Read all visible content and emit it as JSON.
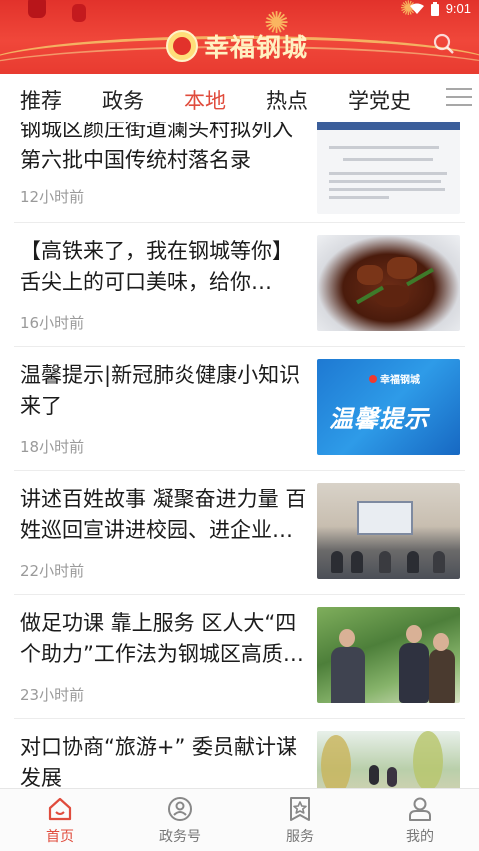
{
  "status_bar": {
    "time": "9:01"
  },
  "header": {
    "brand": "幸福钢城",
    "accent": "#e2322b"
  },
  "tabs": [
    {
      "label": "推荐",
      "active": false
    },
    {
      "label": "政务",
      "active": false
    },
    {
      "label": "本地",
      "active": true
    },
    {
      "label": "热点",
      "active": false
    },
    {
      "label": "学党史",
      "active": false
    }
  ],
  "news": [
    {
      "title": "钢城区颜庄街道澜头村拟列入第六批中国传统村落名录",
      "time": "12小时前",
      "thumb": "document-notice-image"
    },
    {
      "title": "【高铁来了，我在钢城等你】舌尖上的可口美味，给你…",
      "time": "16小时前",
      "thumb": "food-dish-image"
    },
    {
      "title": "温馨提示|新冠肺炎健康小知识来了",
      "time": "18小时前",
      "thumb": "warm-tips-banner",
      "thumb_text": "温馨提示",
      "thumb_brand": "幸福钢城"
    },
    {
      "title": "讲述百姓故事 凝聚奋进力量 百姓巡回宣讲进校园、进企业…",
      "time": "22小时前",
      "thumb": "meeting-room-image"
    },
    {
      "title": "做足功课 靠上服务 区人大“四个助力”工作法为钢城区高质量…",
      "time": "23小时前",
      "thumb": "greenhouse-visit-image"
    },
    {
      "title": "对口协商“旅游+” 委员献计谋发展",
      "time": "",
      "thumb": "park-tour-image"
    }
  ],
  "bottom_nav": [
    {
      "label": "首页",
      "icon": "home-icon",
      "active": true
    },
    {
      "label": "政务号",
      "icon": "gov-account-icon",
      "active": false
    },
    {
      "label": "服务",
      "icon": "service-star-icon",
      "active": false
    },
    {
      "label": "我的",
      "icon": "profile-icon",
      "active": false
    }
  ],
  "colors": {
    "active_tab": "#e04c3d",
    "text": "#1b1b1b",
    "muted": "#9a9a9a"
  }
}
